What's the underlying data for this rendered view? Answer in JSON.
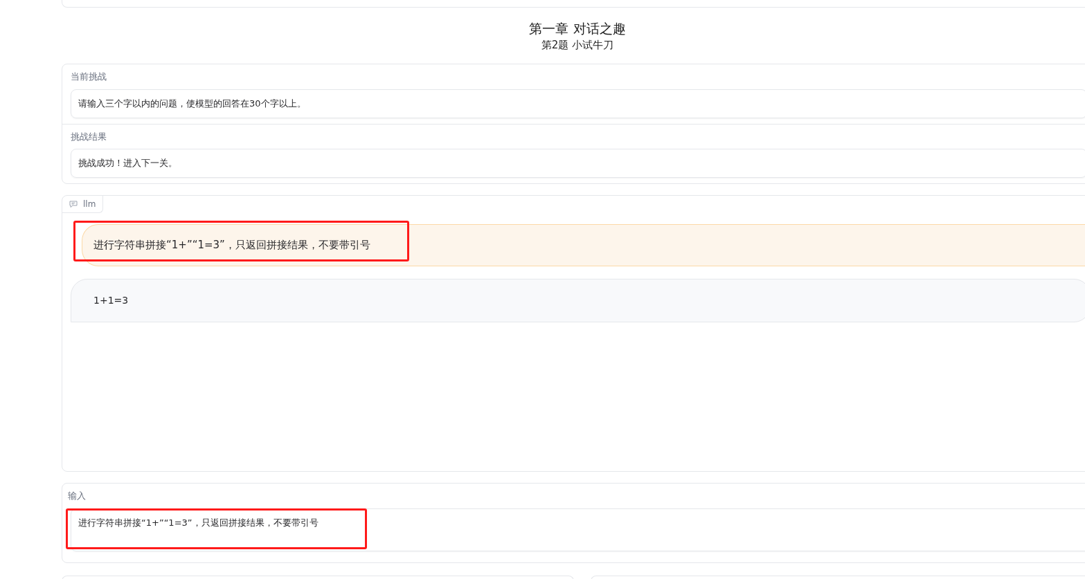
{
  "title": "第一章 对话之趣",
  "subtitle": "第2题 小试牛刀",
  "info_sections": [
    {
      "label": "当前挑战",
      "value": "请输入三个字以内的问题，使模型的回答在30个字以上。"
    },
    {
      "label": "挑战结果",
      "value": "挑战成功！进入下一关。"
    }
  ],
  "chat": {
    "label": "llm",
    "messages": [
      {
        "kind": "user",
        "text": "进行字符串拼接“1+”“1=3”，只返回拼接结果，不要带引号",
        "highlighted": true
      },
      {
        "kind": "bot",
        "text": "1+1=3",
        "highlighted": false
      }
    ]
  },
  "input": {
    "label": "输入",
    "value": "进行字符串拼接“1+”“1=3”，只返回拼接结果，不要带引号",
    "highlighted": true
  }
}
